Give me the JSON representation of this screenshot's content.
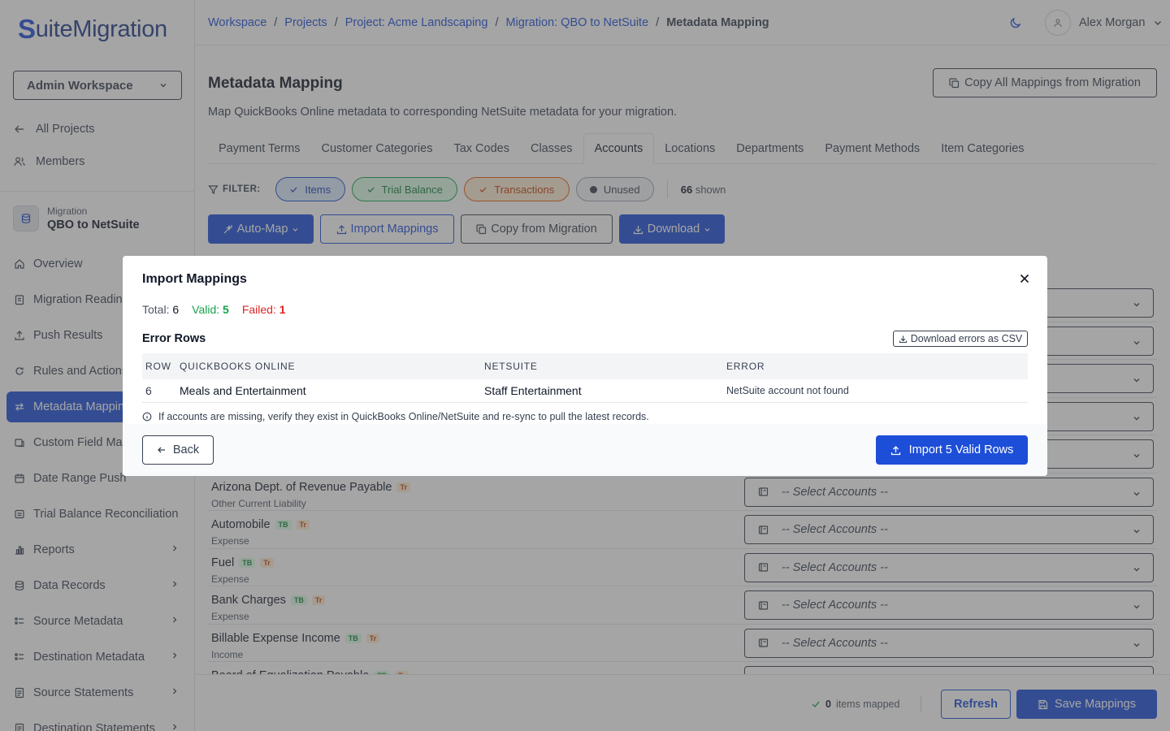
{
  "app": {
    "logo_s": "S",
    "logo_rest": "uiteMigration"
  },
  "sidebar": {
    "workspace_select": "Admin Workspace",
    "top_links": [
      {
        "label": "All Projects",
        "icon": "arrow-left-icon"
      },
      {
        "label": "Members",
        "icon": "users-icon"
      }
    ],
    "migration_small": "Migration",
    "migration_name": "QBO to NetSuite",
    "items": [
      {
        "label": "Overview",
        "icon": "home-icon"
      },
      {
        "label": "Migration Readiness",
        "icon": "clipboard-icon"
      },
      {
        "label": "Push Results",
        "icon": "upload-icon"
      },
      {
        "label": "Rules and Actions",
        "icon": "rules-icon"
      },
      {
        "label": "Metadata Mapping",
        "icon": "swap-icon",
        "active": true
      },
      {
        "label": "Custom Field Mapping",
        "icon": "custom-field-icon"
      },
      {
        "label": "Date Range Push",
        "icon": "calendar-icon"
      },
      {
        "label": "Trial Balance Reconciliation",
        "icon": "balance-icon"
      },
      {
        "label": "Reports",
        "icon": "chart-icon"
      },
      {
        "label": "Data Records",
        "icon": "database-icon"
      },
      {
        "label": "Source Metadata",
        "icon": "list-icon"
      },
      {
        "label": "Destination Metadata",
        "icon": "list-icon"
      },
      {
        "label": "Source Statements",
        "icon": "statement-icon"
      },
      {
        "label": "Destination Statements",
        "icon": "statement-icon"
      }
    ]
  },
  "header": {
    "breadcrumbs": [
      "Workspace",
      "Projects",
      "Project: Acme Landscaping",
      "Migration: QBO to NetSuite"
    ],
    "current": "Metadata Mapping",
    "separator": "/",
    "user_name": "Alex Morgan"
  },
  "main": {
    "title": "Metadata Mapping",
    "subtitle": "Map QuickBooks Online metadata to corresponding NetSuite metadata for your migration.",
    "copy_all_label": "Copy All Mappings from Migration",
    "tabs": [
      "Payment Terms",
      "Customer Categories",
      "Tax Codes",
      "Classes",
      "Accounts",
      "Locations",
      "Departments",
      "Payment Methods",
      "Item Categories"
    ],
    "active_tab": "Accounts",
    "filter_label": "FILTER:",
    "filters": [
      {
        "label": "Items",
        "style": "blue"
      },
      {
        "label": "Trial Balance",
        "style": "green"
      },
      {
        "label": "Transactions",
        "style": "orange"
      },
      {
        "label": "Unused",
        "style": "gray"
      }
    ],
    "shown_count": "66",
    "shown_label": "shown",
    "actions": {
      "auto_map": "Auto-Map",
      "import": "Import Mappings",
      "copy_from": "Copy from Migration",
      "download": "Download"
    },
    "select_placeholder": "-- Select Accounts --",
    "accounts": [
      {
        "name": "",
        "type": "",
        "tags": []
      },
      {
        "name": "",
        "type": "",
        "tags": []
      },
      {
        "name": "",
        "type": "",
        "tags": []
      },
      {
        "name": "",
        "type": "",
        "tags": []
      },
      {
        "name": "",
        "type": "",
        "tags": []
      },
      {
        "name": "Arizona Dept. of Revenue Payable",
        "type": "Other Current Liability",
        "tags": [
          "Tr"
        ]
      },
      {
        "name": "Automobile",
        "type": "Expense",
        "tags": [
          "TB",
          "Tr"
        ]
      },
      {
        "name": "Fuel",
        "type": "Expense",
        "tags": [
          "TB",
          "Tr"
        ]
      },
      {
        "name": "Bank Charges",
        "type": "Expense",
        "tags": [
          "TB",
          "Tr"
        ]
      },
      {
        "name": "Billable Expense Income",
        "type": "Income",
        "tags": [
          "TB",
          "Tr"
        ]
      },
      {
        "name": "Board of Equalization Payable",
        "type": "",
        "tags": [
          "TB",
          "Tr"
        ]
      }
    ],
    "footer": {
      "mapped_count": "0",
      "mapped_label": "items mapped",
      "refresh": "Refresh",
      "save": "Save Mappings"
    }
  },
  "modal": {
    "title": "Import Mappings",
    "total_label": "Total:",
    "total": "6",
    "valid_label": "Valid:",
    "valid": "5",
    "failed_label": "Failed:",
    "failed": "1",
    "error_rows_title": "Error Rows",
    "download_errors": "Download errors as CSV",
    "columns": [
      "ROW",
      "QUICKBOOKS ONLINE",
      "NETSUITE",
      "ERROR"
    ],
    "rows": [
      {
        "row": "6",
        "qbo": "Meals and Entertainment",
        "netsuite": "Staff Entertainment",
        "error": "NetSuite account not found"
      }
    ],
    "info": "If accounts are missing, verify they exist in QuickBooks Online/NetSuite and re-sync to pull the latest records.",
    "back": "Back",
    "import": "Import 5 Valid Rows"
  },
  "colors": {
    "primary": "#1d4ed8",
    "valid": "#16a34a",
    "failed": "#dc2626",
    "overlay": "rgba(75,75,75,0.5)"
  }
}
